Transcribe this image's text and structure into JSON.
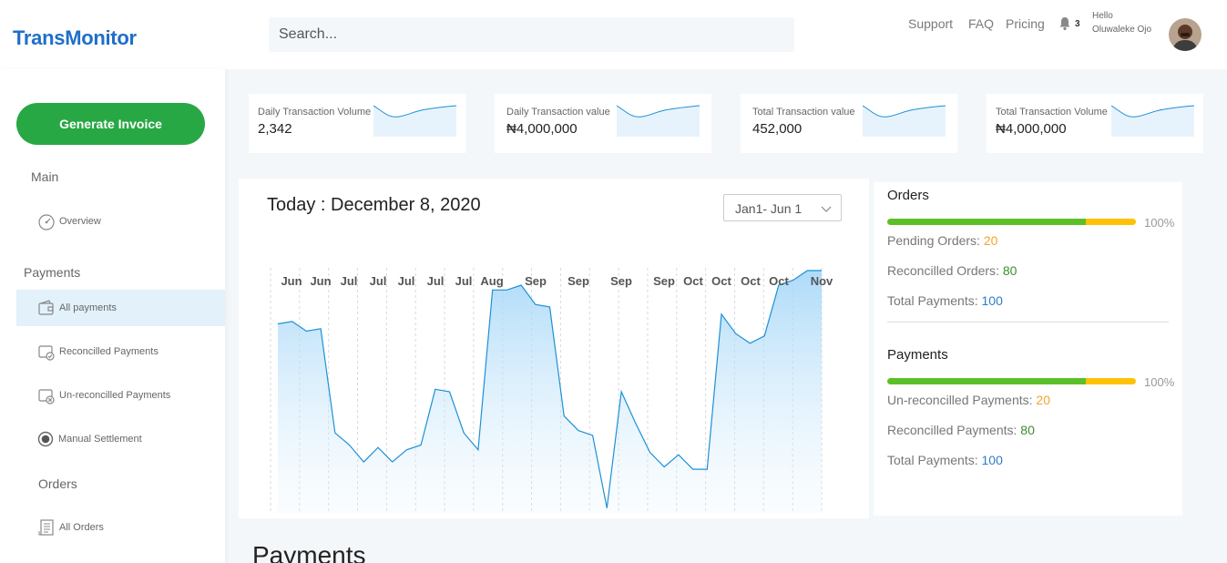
{
  "header": {
    "logo": "TransMonitor",
    "search_placeholder": "Search...",
    "nav": [
      "Support",
      "FAQ",
      "Pricing"
    ],
    "notification_count": "3",
    "greeting": "Hello",
    "user_name": "Oluwaleke Ojo"
  },
  "sidebar": {
    "generate_invoice": "Generate Invoice",
    "main_title": "Main",
    "overview": "Overview",
    "payments_title": "Payments",
    "all_payments": "All payments",
    "reconciled_payments": "Reconcilled Payments",
    "unreconciled_payments": "Un-reconcilled Payments",
    "manual_settlement": "Manual Settlement",
    "orders_title": "Orders",
    "all_orders": "All Orders"
  },
  "stats": [
    {
      "label": "Daily Transaction Volume",
      "value": "2,342"
    },
    {
      "label": "Daily Transaction value",
      "value": "₦4,000,000"
    },
    {
      "label": "Total Transaction value",
      "value": "452,000"
    },
    {
      "label": "Total Transaction Volume",
      "value": "₦4,000,000"
    }
  ],
  "main_chart": {
    "title": "Today : December 8, 2020",
    "range": "Jan1- Jun 1"
  },
  "orders": {
    "title": "Orders",
    "percent": "100%",
    "progress": 0.8,
    "pending_label": "Pending Orders:",
    "pending_value": "20",
    "reconciled_label": "Reconcilled Orders:",
    "reconciled_value": "80",
    "total_label": "Total Payments:",
    "total_value": "100"
  },
  "payments_panel": {
    "title": "Payments",
    "percent": "100%",
    "progress": 0.8,
    "unreconciled_label": "Un-reconcilled Payments:",
    "unreconciled_value": "20",
    "reconciled_label": "Reconcilled Payments:",
    "reconciled_value": "80",
    "total_label": "Total Payments:",
    "total_value": "100"
  },
  "payments_heading": "Payments",
  "chart_data": {
    "type": "area",
    "x": [
      "Jun",
      "Jun",
      "Jul",
      "Jul",
      "Jul",
      "Jul",
      "Jul",
      "Aug",
      "Sep",
      "Sep",
      "Sep",
      "Sep",
      "Oct",
      "Oct",
      "Oct",
      "Oct",
      "Nov"
    ],
    "values": [
      78,
      79,
      75,
      76,
      33,
      28,
      21,
      27,
      21,
      26,
      28,
      51,
      50,
      33,
      26,
      92,
      92,
      94,
      86,
      85,
      40,
      34,
      32,
      2,
      50,
      37,
      25,
      19,
      24,
      18,
      18,
      82,
      74,
      70,
      73,
      94,
      96,
      100,
      100
    ],
    "ylim": [
      0,
      100
    ],
    "color": "#1e90d6"
  },
  "colors": {
    "brand": "#1e6fc9",
    "green": "#27a844",
    "bar_green": "#5cbf2a",
    "bar_yellow": "#ffc107"
  }
}
